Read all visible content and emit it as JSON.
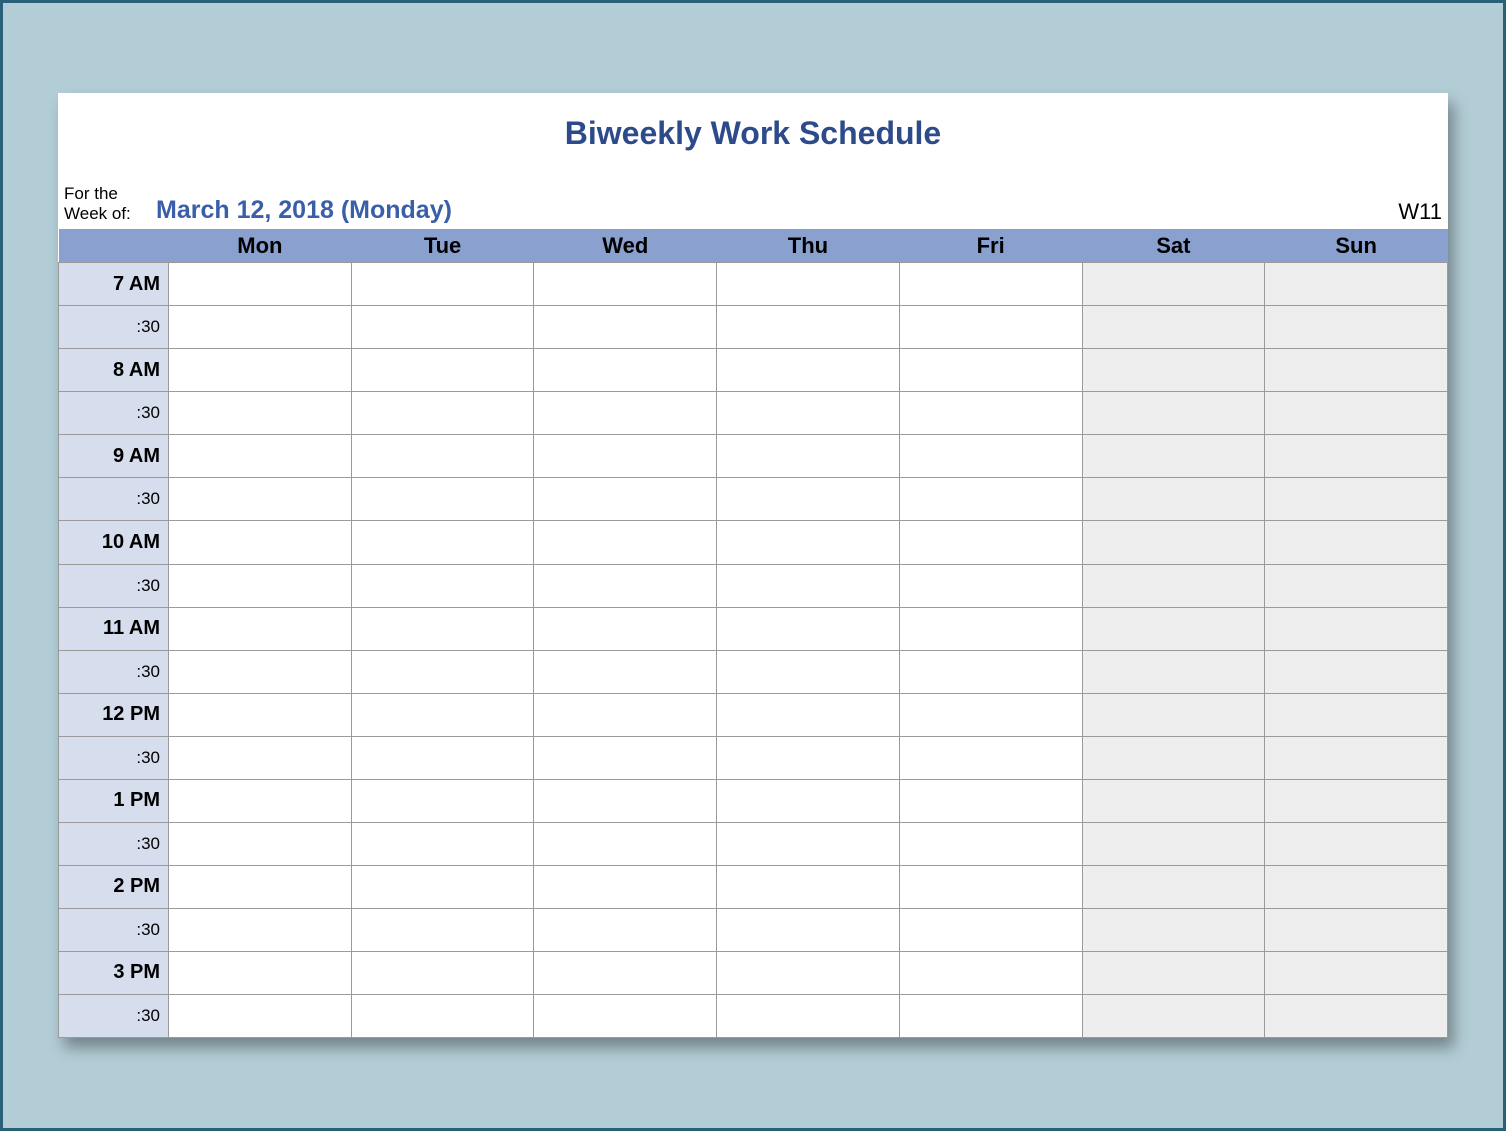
{
  "title": "Biweekly Work Schedule",
  "meta": {
    "label_line1": "For the",
    "label_line2": "Week of:",
    "date_text": "March 12, 2018 (Monday)",
    "week_number": "W11"
  },
  "days": [
    "Mon",
    "Tue",
    "Wed",
    "Thu",
    "Fri",
    "Sat",
    "Sun"
  ],
  "time_rows": [
    {
      "hour": "7 AM",
      "half": ":30"
    },
    {
      "hour": "8 AM",
      "half": ":30"
    },
    {
      "hour": "9 AM",
      "half": ":30"
    },
    {
      "hour": "10 AM",
      "half": ":30"
    },
    {
      "hour": "11 AM",
      "half": ":30"
    },
    {
      "hour": "12 PM",
      "half": ":30"
    },
    {
      "hour": "1 PM",
      "half": ":30"
    },
    {
      "hour": "2 PM",
      "half": ":30"
    },
    {
      "hour": "3 PM",
      "half": ":30"
    }
  ]
}
